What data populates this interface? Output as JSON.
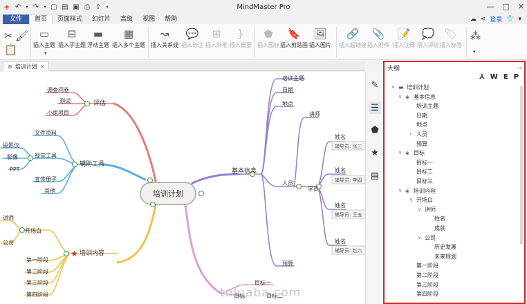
{
  "titlebar": {
    "title": "MindMaster Pro",
    "quick_icons": [
      "app-icon",
      "undo-icon",
      "undo-dropdown-icon",
      "redo-icon",
      "redo-dropdown-icon",
      "new-file-icon",
      "open-folder-icon",
      "save-icon",
      "print-icon",
      "export-icon",
      "customize-icon"
    ],
    "window_controls": [
      "minimize",
      "maximize",
      "close"
    ]
  },
  "menubar": {
    "file": "文件",
    "tabs": [
      "首页",
      "页面样式",
      "幻灯片",
      "高级",
      "视图",
      "帮助"
    ],
    "active_tab": "首页",
    "login": "登录"
  },
  "ribbon": {
    "buttons": [
      {
        "label": "插入主题",
        "enabled": true
      },
      {
        "label": "插入子主题",
        "enabled": true
      },
      {
        "label": "浮动主题",
        "enabled": true
      },
      {
        "label": "插入多个主题",
        "enabled": true
      },
      {
        "label": "插入关系线",
        "enabled": true
      },
      {
        "label": "插入标注",
        "enabled": false
      },
      {
        "label": "插入外框",
        "enabled": false
      },
      {
        "label": "插入概要",
        "enabled": false
      },
      {
        "label": "插入图标",
        "enabled": false
      },
      {
        "label": "插入剪贴画",
        "enabled": true
      },
      {
        "label": "插入图片",
        "enabled": true
      },
      {
        "label": "插入超链接",
        "enabled": false
      },
      {
        "label": "插入附件",
        "enabled": false
      },
      {
        "label": "插入注释",
        "enabled": false
      },
      {
        "label": "插入评论",
        "enabled": false
      },
      {
        "label": "插入标签",
        "enabled": false
      }
    ]
  },
  "doc_tab": {
    "label": "培训计划"
  },
  "mindmap": {
    "central": "培训计划",
    "branches": {
      "pinggu": {
        "label": "评估",
        "children": [
          "调查问卷",
          "测试",
          "小组项目"
        ]
      },
      "fuzhu": {
        "label": "辅助工具",
        "children": [
          "文件资料",
          "视觉工具",
          "宣传册子",
          "其他"
        ],
        "visual_children": [
          "投影仪",
          "影像",
          "PPT"
        ]
      },
      "neirong": {
        "label": "培训内容",
        "children": [
          "开场白",
          "第一阶段",
          "第二阶段",
          "第三阶段",
          "第四阶段"
        ],
        "opening_children": [
          "讲师",
          "公司"
        ]
      },
      "jiben": {
        "label": "基本信息",
        "children": [
          "培训主题",
          "日期",
          "地点",
          "人员",
          "预算"
        ],
        "staff": [
          "讲师",
          "学员"
        ],
        "name_label": "姓名",
        "ids": [
          "辅导员: 张三",
          "辅导员: 李四",
          "辅导员: 王五",
          "辅导员: 赵六"
        ]
      },
      "mubiao": {
        "label": "目标",
        "children": [
          "目标一",
          "目标二"
        ]
      }
    }
  },
  "outline": {
    "title": "大纲",
    "tools": [
      "pdf-icon",
      "W",
      "E",
      "P"
    ],
    "items": [
      {
        "label": "培训计划",
        "level": 0,
        "chev": "v",
        "icon": "folder"
      },
      {
        "label": "基本信息",
        "level": 1,
        "chev": "v",
        "icon": "layers"
      },
      {
        "label": "培训主题",
        "level": 2,
        "chev": "",
        "icon": ""
      },
      {
        "label": "日期",
        "level": 2,
        "chev": "",
        "icon": ""
      },
      {
        "label": "地点",
        "level": 2,
        "chev": "",
        "icon": ""
      },
      {
        "label": "人员",
        "level": 2,
        "chev": ">",
        "icon": ""
      },
      {
        "label": "预算",
        "level": 2,
        "chev": "",
        "icon": ""
      },
      {
        "label": "目标",
        "level": 1,
        "chev": "v",
        "icon": "layers"
      },
      {
        "label": "目标一",
        "level": 2,
        "chev": "",
        "icon": ""
      },
      {
        "label": "目标二",
        "level": 2,
        "chev": "",
        "icon": ""
      },
      {
        "label": "目标三",
        "level": 2,
        "chev": "",
        "icon": ""
      },
      {
        "label": "培训内容",
        "level": 1,
        "chev": "v",
        "icon": "layers"
      },
      {
        "label": "开场白",
        "level": 2,
        "chev": "v",
        "icon": ""
      },
      {
        "label": "讲师",
        "level": 3,
        "chev": "v",
        "icon": ""
      },
      {
        "label": "姓名",
        "level": 4,
        "chev": "",
        "icon": ""
      },
      {
        "label": "成就",
        "level": 4,
        "chev": "",
        "icon": ""
      },
      {
        "label": "公司",
        "level": 3,
        "chev": "v",
        "icon": ""
      },
      {
        "label": "历史发展",
        "level": 4,
        "chev": "",
        "icon": ""
      },
      {
        "label": "未来规划",
        "level": 4,
        "chev": "",
        "icon": ""
      },
      {
        "label": "第一阶段",
        "level": 2,
        "chev": "",
        "icon": ""
      },
      {
        "label": "第二阶段",
        "level": 2,
        "chev": "",
        "icon": ""
      },
      {
        "label": "第三阶段",
        "level": 2,
        "chev": "",
        "icon": ""
      },
      {
        "label": "第四阶段",
        "level": 2,
        "chev": "",
        "icon": ""
      }
    ]
  },
  "sidebar_icons": [
    "format-icon",
    "outline-icon",
    "icon-library-icon",
    "clipart-icon",
    "task-icon"
  ],
  "watermark": "tuluaba.com",
  "colors": {
    "accent": "#3b5fa7",
    "highlight_border": "#e02020",
    "branch_red": "#e87a7a",
    "branch_blue": "#5aaee0",
    "branch_yellow": "#f2c14a",
    "branch_purple": "#9b7fd0",
    "branch_pink": "#d9a0d8"
  }
}
